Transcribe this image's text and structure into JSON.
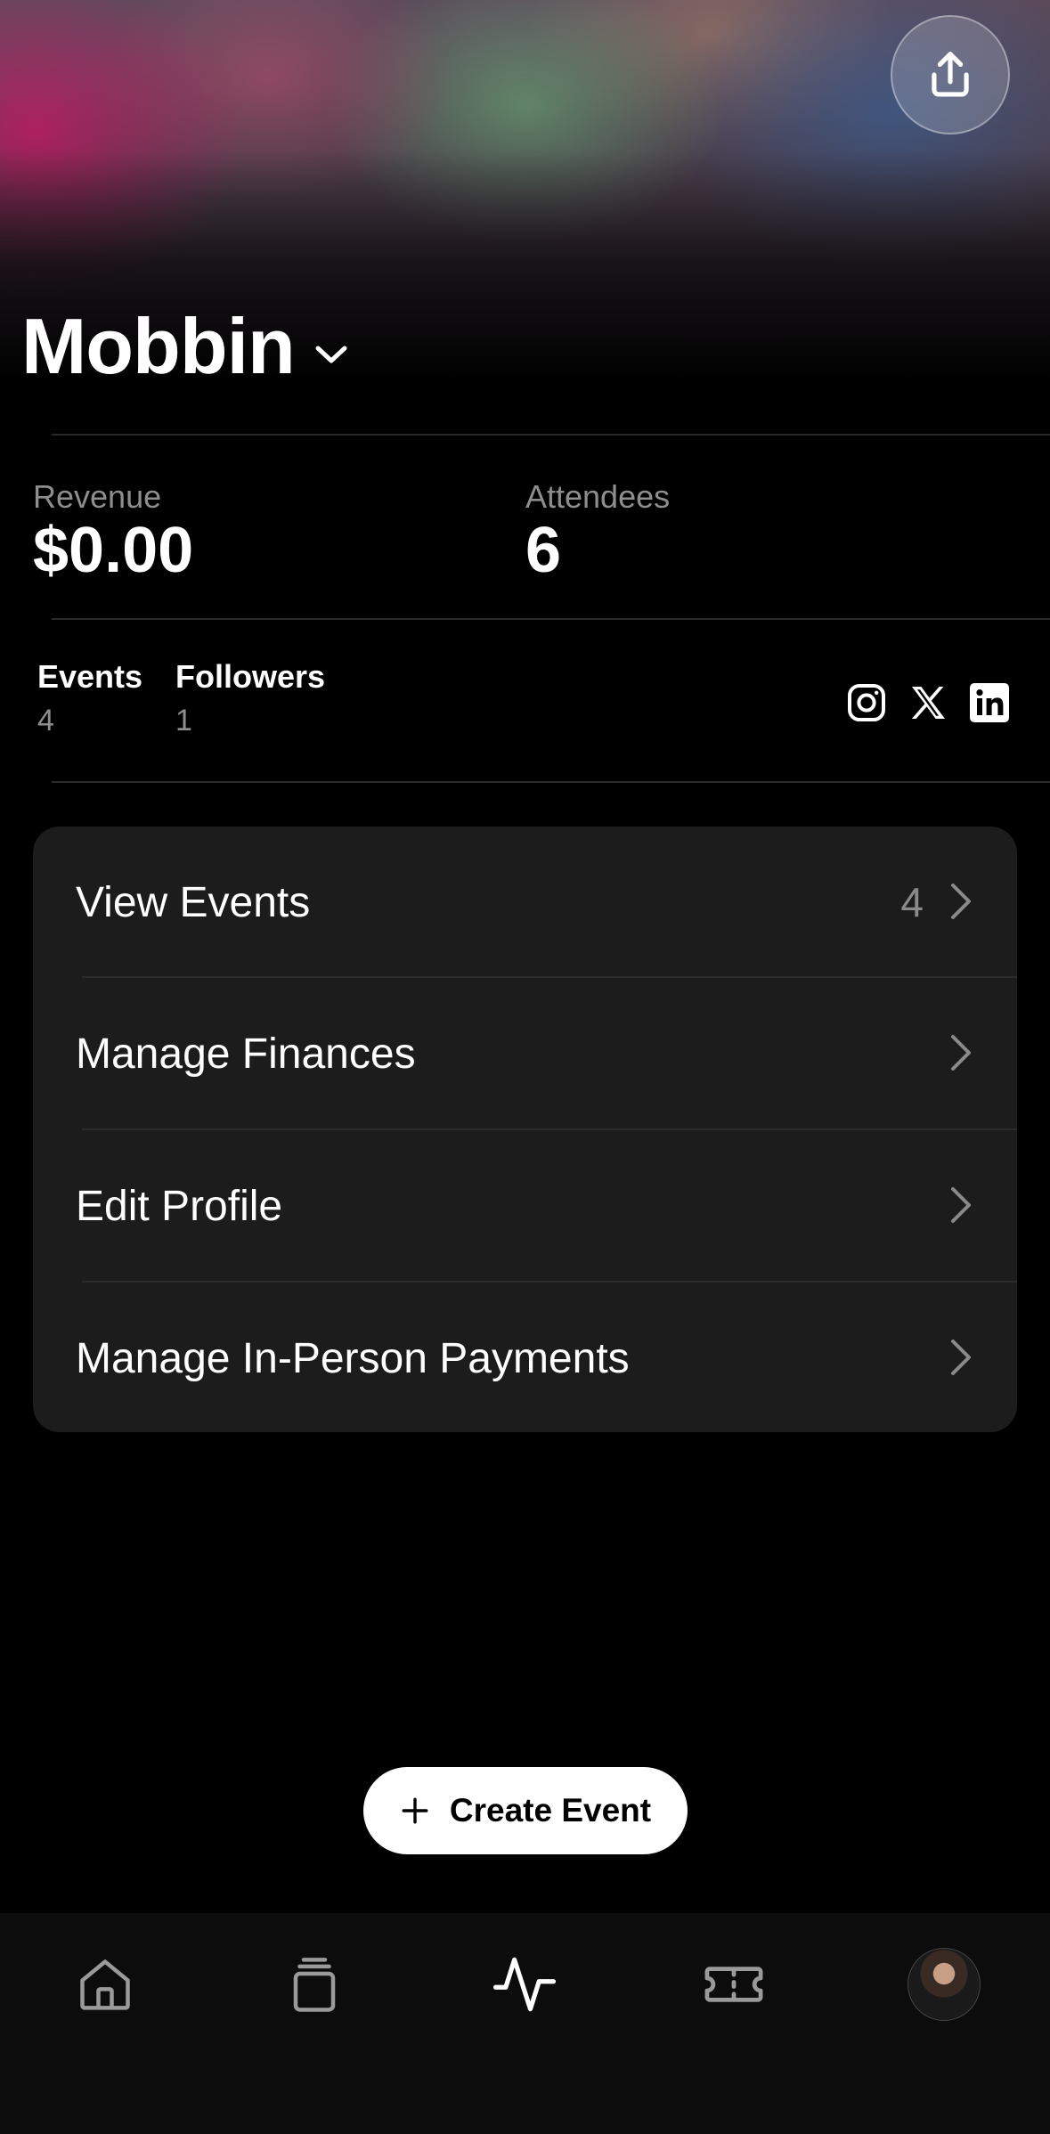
{
  "header": {
    "org_name": "Mobbin"
  },
  "stats": {
    "revenue_label": "Revenue",
    "revenue_value": "$0.00",
    "attendees_label": "Attendees",
    "attendees_value": "6"
  },
  "counts": {
    "events_label": "Events",
    "events_value": "4",
    "followers_label": "Followers",
    "followers_value": "1"
  },
  "social_icons": [
    "instagram-icon",
    "x-icon",
    "linkedin-icon"
  ],
  "menu": [
    {
      "label": "View Events",
      "count": "4"
    },
    {
      "label": "Manage Finances",
      "count": ""
    },
    {
      "label": "Edit Profile",
      "count": ""
    },
    {
      "label": "Manage In-Person Payments",
      "count": ""
    }
  ],
  "create_button": {
    "label": "Create Event"
  },
  "tabbar": {
    "tabs": [
      "home-icon",
      "stack-icon",
      "activity-icon",
      "ticket-icon",
      "avatar"
    ],
    "active": "activity-icon"
  },
  "colors": {
    "background": "#000000",
    "card": "#1c1c1d",
    "muted_text": "#8e8e8e"
  }
}
